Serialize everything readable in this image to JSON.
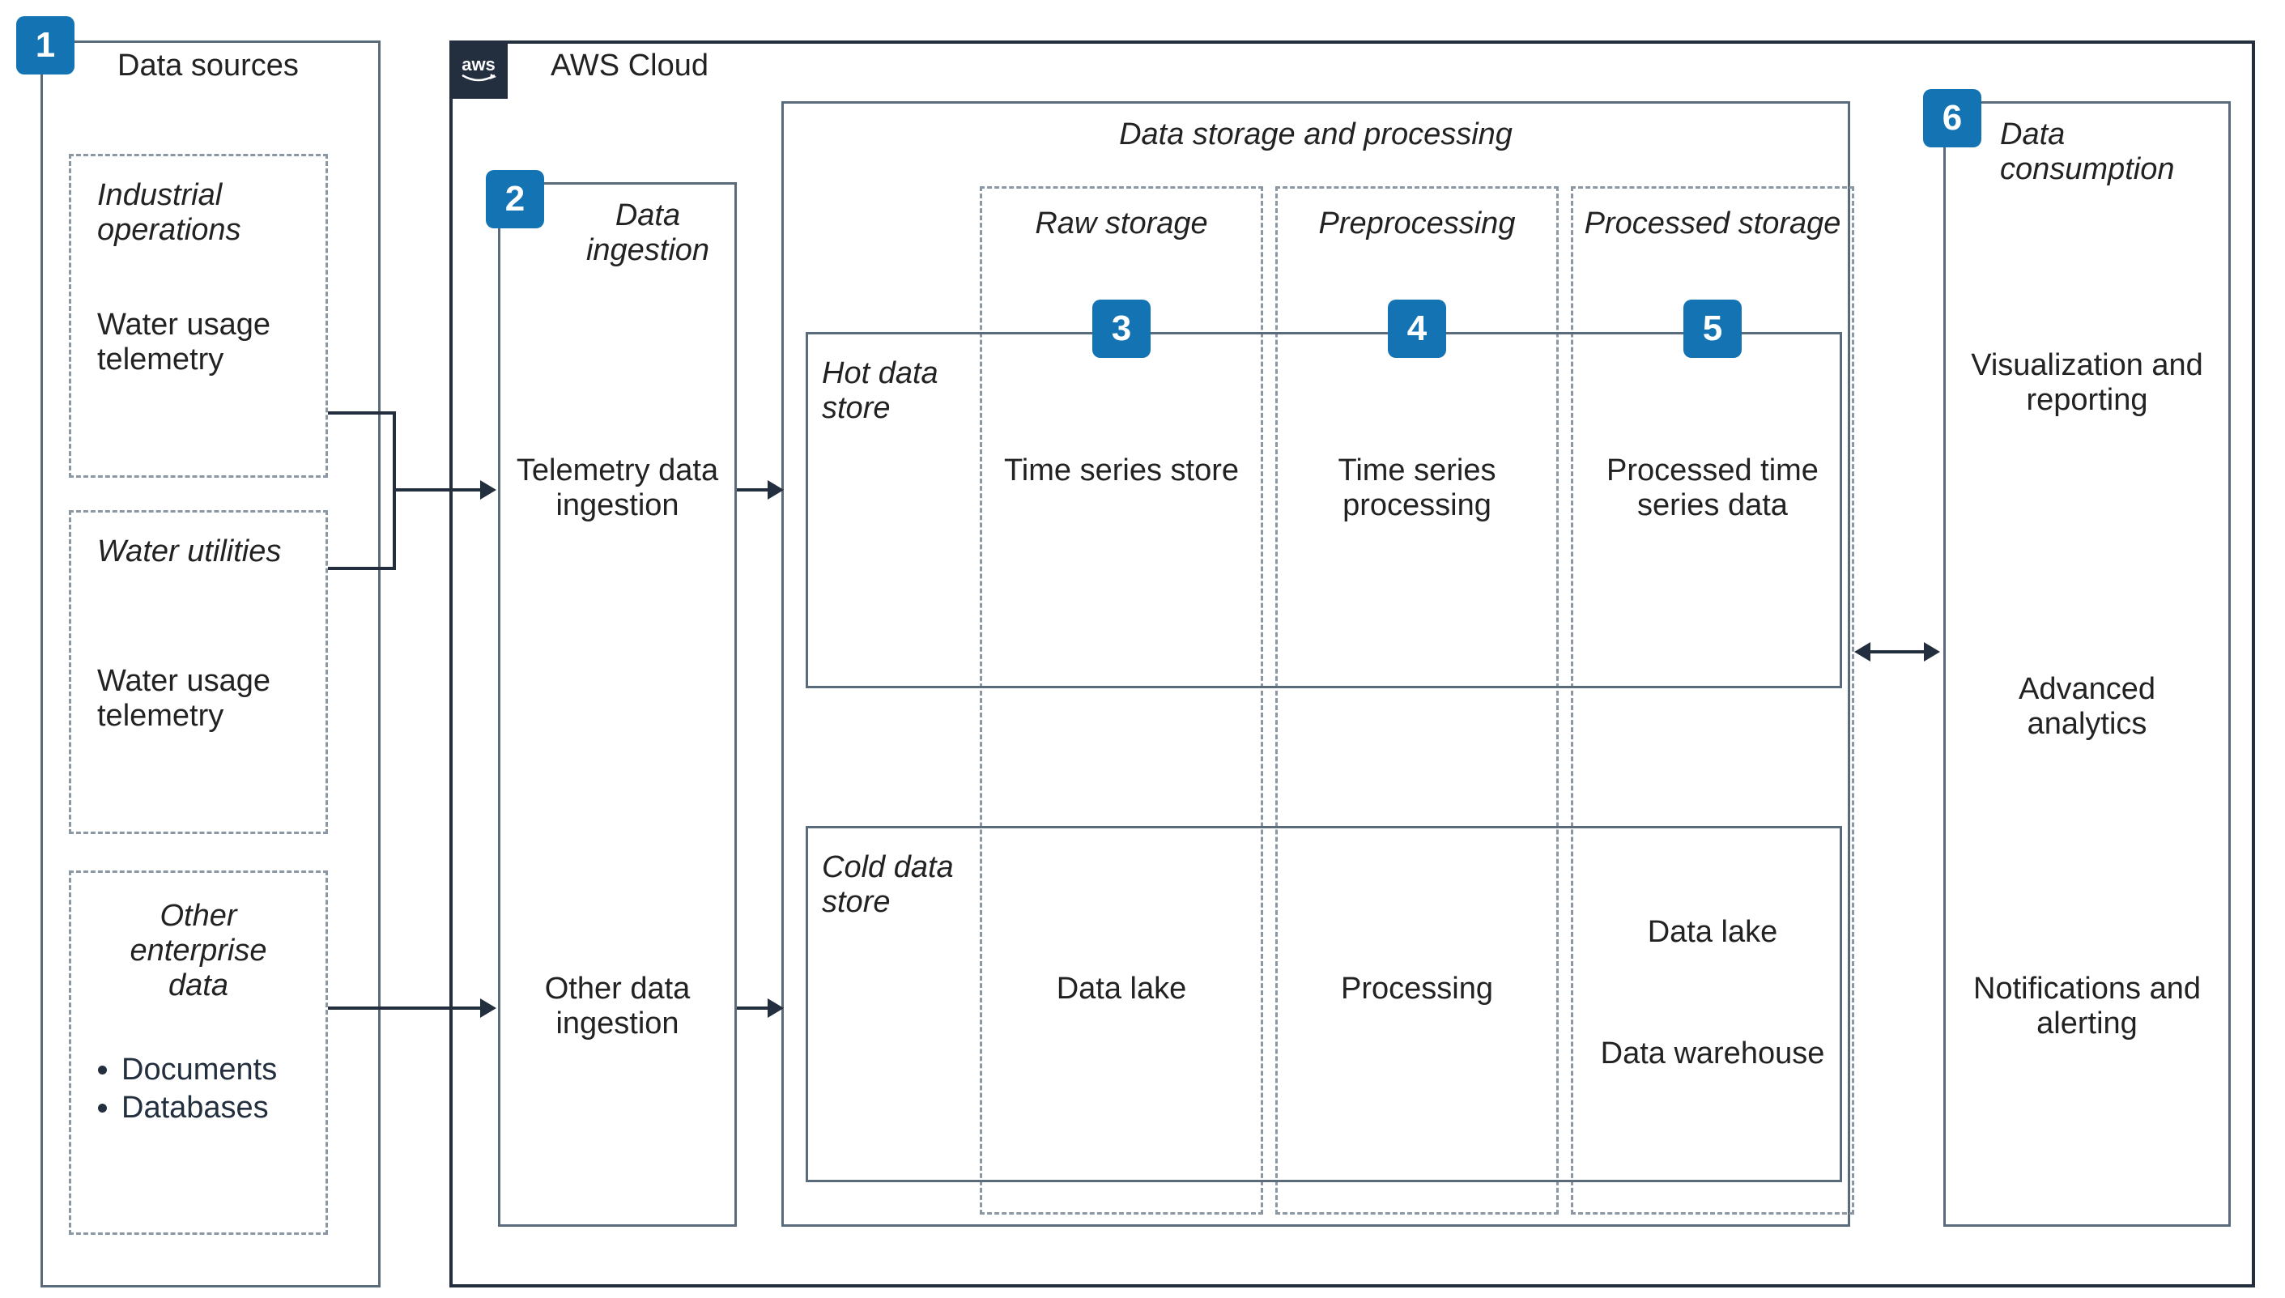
{
  "badges": {
    "n1": "1",
    "n2": "2",
    "n3": "3",
    "n4": "4",
    "n5": "5",
    "n6": "6"
  },
  "sources": {
    "title": "Data sources",
    "industrial_title": "Industrial operations",
    "industrial_item": "Water usage telemetry",
    "utilities_title": "Water utilities",
    "utilities_item": "Water usage telemetry",
    "other_title": "Other enterprise data",
    "other_items": [
      "Documents",
      "Databases"
    ]
  },
  "cloud": {
    "title": "AWS Cloud",
    "aws_text": "aws"
  },
  "ingestion": {
    "title": "Data ingestion",
    "telemetry": "Telemetry data ingestion",
    "other": "Other data ingestion"
  },
  "storage": {
    "title": "Data storage and processing",
    "raw_title": "Raw storage",
    "pre_title": "Preprocessing",
    "proc_title": "Processed storage",
    "hot_title": "Hot data store",
    "cold_title": "Cold data store",
    "hot_raw": "Time series store",
    "hot_pre": "Time series processing",
    "hot_proc": "Processed time series data",
    "cold_raw": "Data lake",
    "cold_pre": "Processing",
    "cold_proc1": "Data lake",
    "cold_proc2": "Data warehouse"
  },
  "consumption": {
    "title": "Data consumption",
    "viz": "Visualization and reporting",
    "analytics": "Advanced analytics",
    "notify": "Notifications and alerting"
  }
}
